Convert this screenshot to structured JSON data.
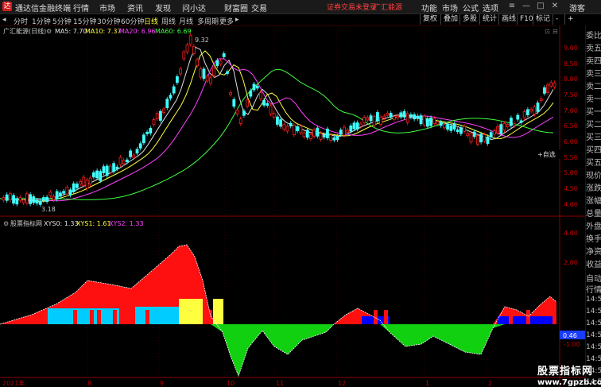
{
  "titlebar": {
    "app_title": "通达信金融终端",
    "menus": [
      "行情",
      "市场",
      "资讯",
      "发现",
      "问小达",
      "财富圈",
      "交易"
    ],
    "red_links": [
      "证券交易未登录",
      "广汇能源"
    ],
    "right_menus": [
      "功能",
      "市场",
      "公式",
      "选项"
    ],
    "user": "游客"
  },
  "periods": [
    "分时",
    "1分钟",
    "5分钟",
    "15分钟",
    "30分钟",
    "60分钟",
    "日线",
    "周线",
    "月线",
    "多周期",
    "更多"
  ],
  "active_period": "日线",
  "toolbar_buttons": [
    "复权",
    "叠加",
    "多股",
    "统计",
    "画线",
    "F10",
    "标记",
    "-",
    "+"
  ],
  "main_chart": {
    "legend_title": "广汇能源(日线)",
    "ma": [
      {
        "label": "MA5: 7.70",
        "color": "#e0e0e0"
      },
      {
        "label": "MA10: 7.37",
        "color": "#ffff40"
      },
      {
        "label": "MA20: 6.96",
        "color": "#ff40ff"
      },
      {
        "label": "MA60: 6.69",
        "color": "#40ff40"
      }
    ],
    "high_label": "9.32",
    "low_label": "3.18",
    "self_select": "+自选",
    "y_ticks": [
      "9.00",
      "8.50",
      "8.00",
      "7.50",
      "7.00",
      "6.50",
      "6.00",
      "5.50",
      "5.00",
      "4.50",
      "4.00"
    ]
  },
  "indicator": {
    "legend_title": "股票指标网",
    "series": [
      {
        "label": "XYS0: 1.33",
        "color": "#e0e0e0"
      },
      {
        "label": "XYS1: 1.61",
        "color": "#ffff40"
      },
      {
        "label": "XYS2: 1.33",
        "color": "#ff40ff"
      }
    ],
    "y_ticks": [
      "4.00",
      "2.00",
      "0.00",
      "-1.00"
    ],
    "current_value": "0.46"
  },
  "x_axis": {
    "labels": [
      "2021年",
      "8",
      "9",
      "10",
      "11",
      "12",
      "1",
      "2"
    ]
  },
  "right_panel": [
    "委比",
    "卖五",
    "卖四",
    "卖三",
    "卖二",
    "卖一",
    "买一",
    "买二",
    "买三",
    "买四",
    "买五",
    "现价",
    "涨跌",
    "涨幅",
    "总量",
    "外盘",
    "换手",
    "净资",
    "收益",
    "自动",
    "行情",
    "14:50",
    "14:50",
    "14:50",
    "14:50",
    "14:50",
    "14:50",
    "14:50",
    "14:50"
  ],
  "watermark": {
    "line1": "股票指标网",
    "line2": "www.7gpzb.com"
  },
  "colors": {
    "up": "#ff2020",
    "down": "#40ffff",
    "axis": "#8b0000",
    "bullish_area": "#ff1010",
    "bearish_area": "#10e010",
    "blue": "#0000ff",
    "cyan": "#00ccff"
  }
}
